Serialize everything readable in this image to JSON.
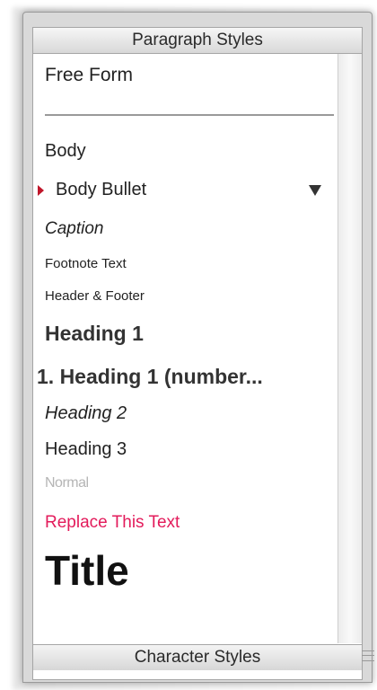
{
  "panel": {
    "paragraph_header": "Paragraph Styles",
    "character_header": "Character Styles"
  },
  "styles": [
    {
      "label": "Free Form"
    },
    {
      "label": "Body"
    },
    {
      "label": "Body Bullet",
      "selected": true
    },
    {
      "label": "Caption"
    },
    {
      "label": "Footnote Text"
    },
    {
      "label": "Header & Footer"
    },
    {
      "label": "Heading 1"
    },
    {
      "label": "1. Heading 1 (number..."
    },
    {
      "label": "Heading 2"
    },
    {
      "label": "Heading 3"
    },
    {
      "label": "Normal"
    },
    {
      "label": "Replace This Text"
    },
    {
      "label": "Title"
    }
  ],
  "icons": {
    "selected_marker": "right-triangle-icon",
    "style_menu": "dropdown-arrow-icon",
    "resize_grip": "grip-icon"
  },
  "colors": {
    "accent": "#e31b5b",
    "marker": "#c0162a",
    "muted": "#b5b5b5"
  }
}
